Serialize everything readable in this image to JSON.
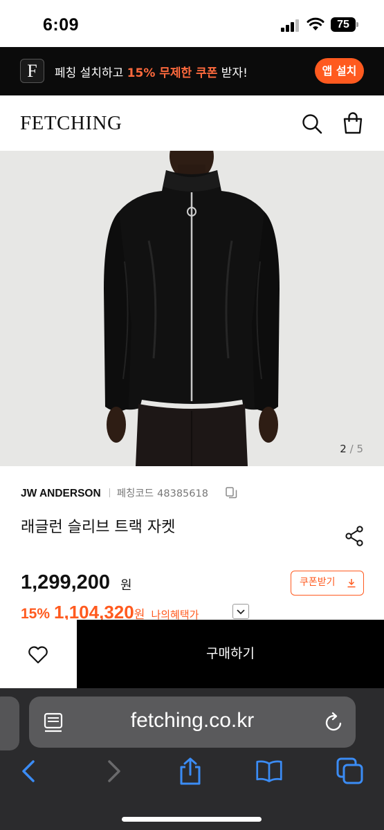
{
  "status_bar": {
    "time": "6:09",
    "battery": "75",
    "icons": [
      "signal-icon",
      "wifi-icon",
      "battery-icon"
    ]
  },
  "promo": {
    "logo_letter": "F",
    "text_before": "페칭 설치하고 ",
    "highlight": "15% 무제한 쿠폰",
    "text_after": " 받자!",
    "install_label": "앱 설치"
  },
  "header": {
    "logo": "FETCHING",
    "icons": [
      "search-icon",
      "shopping-bag-icon"
    ]
  },
  "gallery": {
    "current": "2",
    "separator": "/",
    "total": "5"
  },
  "product": {
    "brand": "JW ANDERSON",
    "code_label": "페칭코드",
    "code_value": "48385618",
    "name": "래글런 슬리브 트랙 자켓",
    "price": "1,299,200",
    "price_unit": "원",
    "coupon_label": "쿠폰받기",
    "sale_percent": "15%",
    "sale_price": "1,104,320",
    "sale_unit": "원",
    "benefit_label": "나의혜택가"
  },
  "purchase": {
    "buy_label": "구매하기"
  },
  "browser": {
    "url": "fetching.co.kr",
    "toolbar_icons": [
      "back-icon",
      "forward-icon",
      "share-icon",
      "bookmarks-icon",
      "tabs-icon"
    ]
  },
  "colors": {
    "accent": "#ff5a1f",
    "banner_bg": "#0b0b0b",
    "browser_bg": "#2b2b2d",
    "safari_blue": "#3b8cf5"
  }
}
